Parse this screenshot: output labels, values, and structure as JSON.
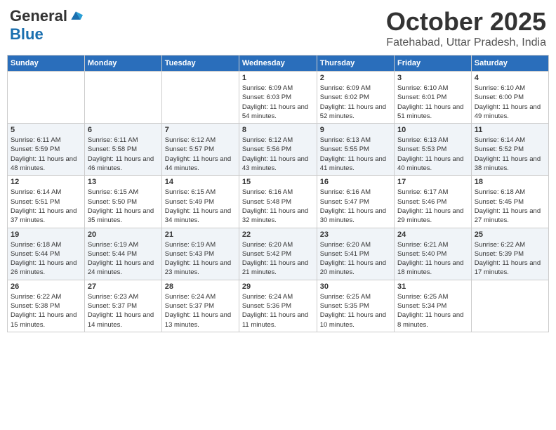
{
  "logo": {
    "general": "General",
    "blue": "Blue"
  },
  "header": {
    "month": "October 2025",
    "location": "Fatehabad, Uttar Pradesh, India"
  },
  "weekdays": [
    "Sunday",
    "Monday",
    "Tuesday",
    "Wednesday",
    "Thursday",
    "Friday",
    "Saturday"
  ],
  "weeks": [
    [
      {
        "day": "",
        "info": ""
      },
      {
        "day": "",
        "info": ""
      },
      {
        "day": "",
        "info": ""
      },
      {
        "day": "1",
        "info": "Sunrise: 6:09 AM\nSunset: 6:03 PM\nDaylight: 11 hours and 54 minutes."
      },
      {
        "day": "2",
        "info": "Sunrise: 6:09 AM\nSunset: 6:02 PM\nDaylight: 11 hours and 52 minutes."
      },
      {
        "day": "3",
        "info": "Sunrise: 6:10 AM\nSunset: 6:01 PM\nDaylight: 11 hours and 51 minutes."
      },
      {
        "day": "4",
        "info": "Sunrise: 6:10 AM\nSunset: 6:00 PM\nDaylight: 11 hours and 49 minutes."
      }
    ],
    [
      {
        "day": "5",
        "info": "Sunrise: 6:11 AM\nSunset: 5:59 PM\nDaylight: 11 hours and 48 minutes."
      },
      {
        "day": "6",
        "info": "Sunrise: 6:11 AM\nSunset: 5:58 PM\nDaylight: 11 hours and 46 minutes."
      },
      {
        "day": "7",
        "info": "Sunrise: 6:12 AM\nSunset: 5:57 PM\nDaylight: 11 hours and 44 minutes."
      },
      {
        "day": "8",
        "info": "Sunrise: 6:12 AM\nSunset: 5:56 PM\nDaylight: 11 hours and 43 minutes."
      },
      {
        "day": "9",
        "info": "Sunrise: 6:13 AM\nSunset: 5:55 PM\nDaylight: 11 hours and 41 minutes."
      },
      {
        "day": "10",
        "info": "Sunrise: 6:13 AM\nSunset: 5:53 PM\nDaylight: 11 hours and 40 minutes."
      },
      {
        "day": "11",
        "info": "Sunrise: 6:14 AM\nSunset: 5:52 PM\nDaylight: 11 hours and 38 minutes."
      }
    ],
    [
      {
        "day": "12",
        "info": "Sunrise: 6:14 AM\nSunset: 5:51 PM\nDaylight: 11 hours and 37 minutes."
      },
      {
        "day": "13",
        "info": "Sunrise: 6:15 AM\nSunset: 5:50 PM\nDaylight: 11 hours and 35 minutes."
      },
      {
        "day": "14",
        "info": "Sunrise: 6:15 AM\nSunset: 5:49 PM\nDaylight: 11 hours and 34 minutes."
      },
      {
        "day": "15",
        "info": "Sunrise: 6:16 AM\nSunset: 5:48 PM\nDaylight: 11 hours and 32 minutes."
      },
      {
        "day": "16",
        "info": "Sunrise: 6:16 AM\nSunset: 5:47 PM\nDaylight: 11 hours and 30 minutes."
      },
      {
        "day": "17",
        "info": "Sunrise: 6:17 AM\nSunset: 5:46 PM\nDaylight: 11 hours and 29 minutes."
      },
      {
        "day": "18",
        "info": "Sunrise: 6:18 AM\nSunset: 5:45 PM\nDaylight: 11 hours and 27 minutes."
      }
    ],
    [
      {
        "day": "19",
        "info": "Sunrise: 6:18 AM\nSunset: 5:44 PM\nDaylight: 11 hours and 26 minutes."
      },
      {
        "day": "20",
        "info": "Sunrise: 6:19 AM\nSunset: 5:44 PM\nDaylight: 11 hours and 24 minutes."
      },
      {
        "day": "21",
        "info": "Sunrise: 6:19 AM\nSunset: 5:43 PM\nDaylight: 11 hours and 23 minutes."
      },
      {
        "day": "22",
        "info": "Sunrise: 6:20 AM\nSunset: 5:42 PM\nDaylight: 11 hours and 21 minutes."
      },
      {
        "day": "23",
        "info": "Sunrise: 6:20 AM\nSunset: 5:41 PM\nDaylight: 11 hours and 20 minutes."
      },
      {
        "day": "24",
        "info": "Sunrise: 6:21 AM\nSunset: 5:40 PM\nDaylight: 11 hours and 18 minutes."
      },
      {
        "day": "25",
        "info": "Sunrise: 6:22 AM\nSunset: 5:39 PM\nDaylight: 11 hours and 17 minutes."
      }
    ],
    [
      {
        "day": "26",
        "info": "Sunrise: 6:22 AM\nSunset: 5:38 PM\nDaylight: 11 hours and 15 minutes."
      },
      {
        "day": "27",
        "info": "Sunrise: 6:23 AM\nSunset: 5:37 PM\nDaylight: 11 hours and 14 minutes."
      },
      {
        "day": "28",
        "info": "Sunrise: 6:24 AM\nSunset: 5:37 PM\nDaylight: 11 hours and 13 minutes."
      },
      {
        "day": "29",
        "info": "Sunrise: 6:24 AM\nSunset: 5:36 PM\nDaylight: 11 hours and 11 minutes."
      },
      {
        "day": "30",
        "info": "Sunrise: 6:25 AM\nSunset: 5:35 PM\nDaylight: 11 hours and 10 minutes."
      },
      {
        "day": "31",
        "info": "Sunrise: 6:25 AM\nSunset: 5:34 PM\nDaylight: 11 hours and 8 minutes."
      },
      {
        "day": "",
        "info": ""
      }
    ]
  ]
}
